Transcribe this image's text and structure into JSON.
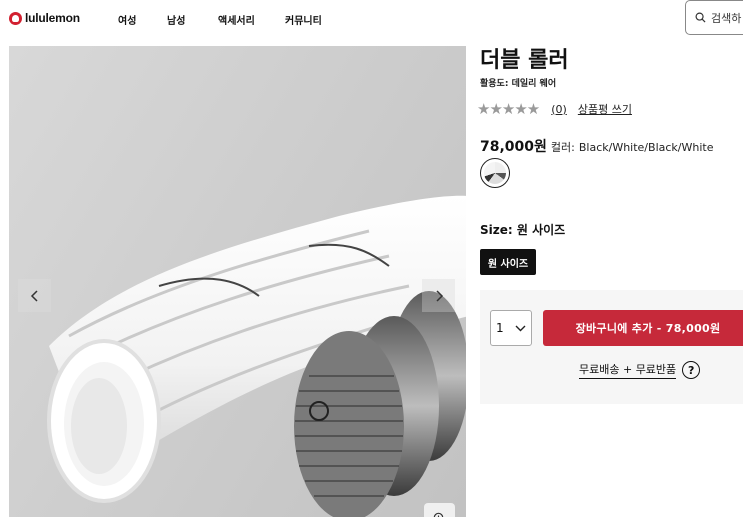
{
  "header": {
    "logo_text": "lululemon",
    "nav": [
      {
        "label": "여성"
      },
      {
        "label": "남성"
      },
      {
        "label": "액세서리"
      },
      {
        "label": "커뮤니티"
      }
    ],
    "search_placeholder": "검색하"
  },
  "product": {
    "title": "더블 롤러",
    "activity": "활용도: 데일리 웨어",
    "rating_stars": 0,
    "review_count": "(0)",
    "write_review": "상품평 쓰기",
    "price": "78,000원",
    "color_label": "컬러:",
    "color_value": "Black/White/Black/White",
    "size_label": "Size: 원 사이즈",
    "size_option": "원 사이즈"
  },
  "cart": {
    "quantity": "1",
    "add_to_cart": "장바구니에 추가 - 78,000원",
    "shipping_text": "무료배송 + 무료반품",
    "help_glyph": "?"
  },
  "colors": {
    "accent_red": "#c6293a",
    "logo_red": "#d22030",
    "dark": "#111111"
  }
}
